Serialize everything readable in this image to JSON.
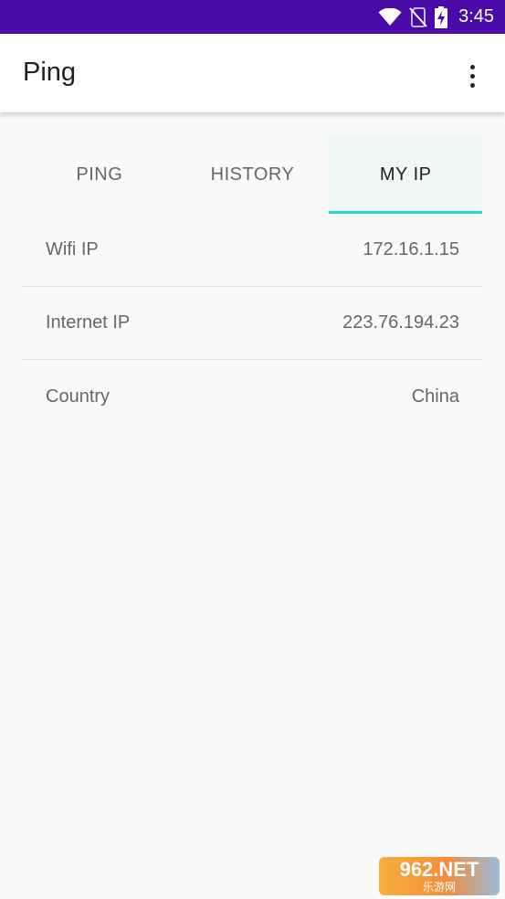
{
  "status_bar": {
    "time": "3:45",
    "color": "#4a0aa8",
    "icons": [
      "wifi-icon",
      "no-sim-icon",
      "battery-charging-icon"
    ]
  },
  "app_bar": {
    "title": "Ping",
    "overflow_icon": "more-vert-icon"
  },
  "tabs": [
    {
      "label": "PING",
      "active": false
    },
    {
      "label": "HISTORY",
      "active": false
    },
    {
      "label": "MY IP",
      "active": true
    }
  ],
  "accent_color": "#2ed6cf",
  "info": [
    {
      "label": "Wifi IP",
      "value": "172.16.1.15"
    },
    {
      "label": "Internet IP",
      "value": "223.76.194.23"
    },
    {
      "label": "Country",
      "value": "China"
    }
  ],
  "watermark": {
    "logo": "962.NET",
    "sub": "乐游网"
  }
}
